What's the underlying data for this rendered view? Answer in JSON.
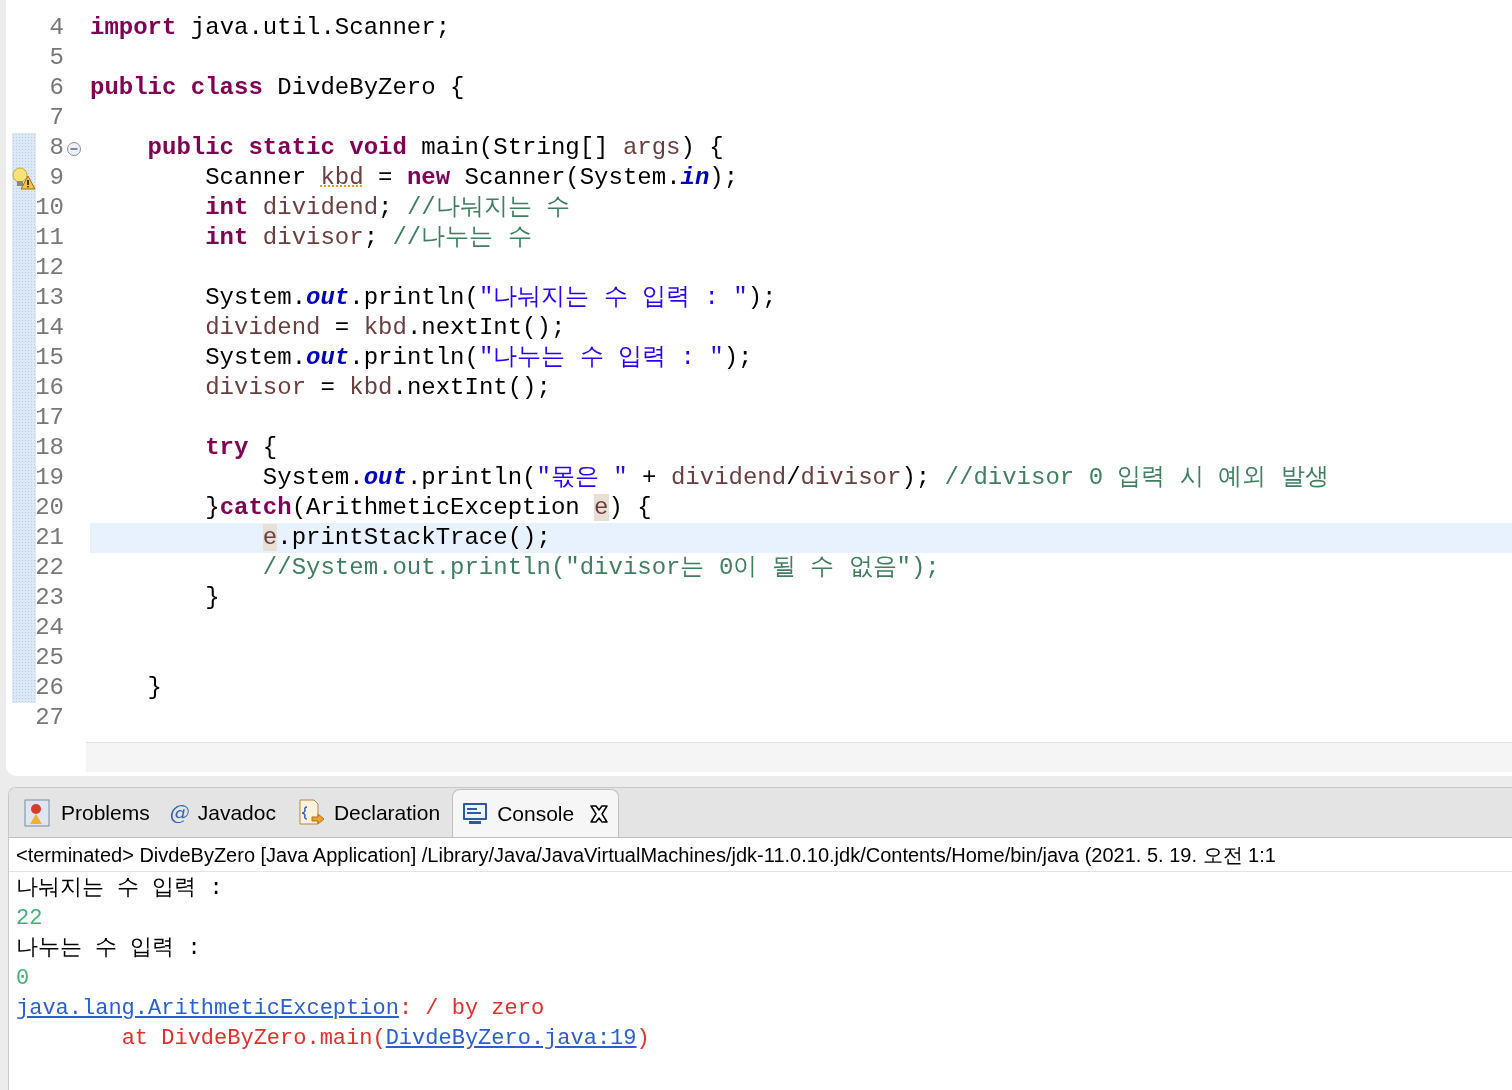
{
  "editor": {
    "lines": [
      {
        "number": "4",
        "current": false,
        "in_range": false,
        "tokens": [
          {
            "kind": "keyword",
            "text": "import"
          },
          {
            "kind": "plain",
            "text": " java.util.Scanner;"
          }
        ]
      },
      {
        "number": "5",
        "current": false,
        "in_range": false
      },
      {
        "number": "6",
        "current": false,
        "in_range": false,
        "tokens": [
          {
            "kind": "keyword",
            "text": "public class"
          },
          {
            "kind": "plain",
            "text": " DivdeByZero {"
          }
        ]
      },
      {
        "number": "7",
        "current": false,
        "in_range": false
      },
      {
        "number": "8",
        "current": false,
        "in_range": true,
        "kind": "fold",
        "tokens": [
          {
            "kind": "keyword",
            "text": "    public static void"
          },
          {
            "kind": "plain",
            "text": " main(String[] "
          },
          {
            "kind": "local",
            "text": "args"
          },
          {
            "kind": "plain",
            "text": ") {"
          }
        ]
      },
      {
        "number": "9",
        "current": false,
        "in_range": true,
        "kind": "warning",
        "tokens": [
          {
            "kind": "plain",
            "text": "        Scanner "
          },
          {
            "kind": "warning",
            "text": "kbd"
          },
          {
            "kind": "plain",
            "text": " = "
          },
          {
            "kind": "keyword",
            "text": "new"
          },
          {
            "kind": "plain",
            "text": " Scanner(System."
          },
          {
            "kind": "field",
            "text": "in"
          },
          {
            "kind": "plain",
            "text": ");"
          }
        ]
      },
      {
        "number": "10",
        "current": false,
        "in_range": true,
        "tokens": [
          {
            "kind": "keyword",
            "text": "        int"
          },
          {
            "kind": "local",
            "text": " dividend"
          },
          {
            "kind": "plain",
            "text": "; "
          },
          {
            "kind": "comment",
            "text": "//나눠지는 수"
          }
        ]
      },
      {
        "number": "11",
        "current": false,
        "in_range": true,
        "tokens": [
          {
            "kind": "keyword",
            "text": "        int"
          },
          {
            "kind": "local",
            "text": " divisor"
          },
          {
            "kind": "plain",
            "text": "; "
          },
          {
            "kind": "comment",
            "text": "//나누는 수"
          }
        ]
      },
      {
        "number": "12",
        "current": false,
        "in_range": true
      },
      {
        "number": "13",
        "current": false,
        "in_range": true,
        "tokens": [
          {
            "kind": "plain",
            "text": "        System."
          },
          {
            "kind": "field",
            "text": "out"
          },
          {
            "kind": "plain",
            "text": ".println("
          },
          {
            "kind": "string",
            "text": "\"나눠지는 수 입력 : \""
          },
          {
            "kind": "plain",
            "text": ");"
          }
        ]
      },
      {
        "number": "14",
        "current": false,
        "in_range": true,
        "tokens": [
          {
            "kind": "local",
            "text": "        dividend"
          },
          {
            "kind": "plain",
            "text": " = "
          },
          {
            "kind": "local",
            "text": "kbd"
          },
          {
            "kind": "plain",
            "text": ".nextInt();"
          }
        ]
      },
      {
        "number": "15",
        "current": false,
        "in_range": true,
        "tokens": [
          {
            "kind": "plain",
            "text": "        System."
          },
          {
            "kind": "field",
            "text": "out"
          },
          {
            "kind": "plain",
            "text": ".println("
          },
          {
            "kind": "string",
            "text": "\"나누는 수 입력 : \""
          },
          {
            "kind": "plain",
            "text": ");"
          }
        ]
      },
      {
        "number": "16",
        "current": false,
        "in_range": true,
        "tokens": [
          {
            "kind": "local",
            "text": "        divisor"
          },
          {
            "kind": "plain",
            "text": " = "
          },
          {
            "kind": "local",
            "text": "kbd"
          },
          {
            "kind": "plain",
            "text": ".nextInt();"
          }
        ]
      },
      {
        "number": "17",
        "current": false,
        "in_range": true
      },
      {
        "number": "18",
        "current": false,
        "in_range": true,
        "tokens": [
          {
            "kind": "keyword",
            "text": "        try"
          },
          {
            "kind": "plain",
            "text": " {"
          }
        ]
      },
      {
        "number": "19",
        "current": false,
        "in_range": true,
        "tokens": [
          {
            "kind": "plain",
            "text": "            System."
          },
          {
            "kind": "field",
            "text": "out"
          },
          {
            "kind": "plain",
            "text": ".println("
          },
          {
            "kind": "string",
            "text": "\"몫은 \""
          },
          {
            "kind": "plain",
            "text": " + "
          },
          {
            "kind": "local",
            "text": "dividend"
          },
          {
            "kind": "plain",
            "text": "/"
          },
          {
            "kind": "local",
            "text": "divisor"
          },
          {
            "kind": "plain",
            "text": "); "
          },
          {
            "kind": "comment",
            "text": "//divisor 0 입력 시 예외 발생"
          }
        ]
      },
      {
        "number": "20",
        "current": false,
        "in_range": true,
        "tokens": [
          {
            "kind": "plain",
            "text": "        }"
          },
          {
            "kind": "keyword",
            "text": "catch"
          },
          {
            "kind": "plain",
            "text": "(ArithmeticException "
          },
          {
            "kind": "occurrence",
            "text": "e"
          },
          {
            "kind": "plain",
            "text": ") {"
          }
        ]
      },
      {
        "number": "21",
        "current": true,
        "in_range": true,
        "tokens": [
          {
            "kind": "occurrence",
            "text": "            e"
          },
          {
            "kind": "plain",
            "text": ".printStackTrace();"
          }
        ]
      },
      {
        "number": "22",
        "current": false,
        "in_range": true,
        "tokens": [
          {
            "kind": "comment",
            "text": "            //System.out.println(\"divisor는 0이 될 수 없음\");"
          }
        ]
      },
      {
        "number": "23",
        "current": false,
        "in_range": true,
        "tokens": [
          {
            "kind": "plain",
            "text": "        }"
          }
        ]
      },
      {
        "number": "24",
        "current": false,
        "in_range": true
      },
      {
        "number": "25",
        "current": false,
        "in_range": true
      },
      {
        "number": "26",
        "current": false,
        "in_range": true,
        "tokens": [
          {
            "kind": "plain",
            "text": "    }"
          }
        ]
      },
      {
        "number": "27",
        "current": false,
        "in_range": false
      }
    ]
  },
  "tabs": [
    {
      "kind": "problems",
      "label": "Problems",
      "selected": false
    },
    {
      "kind": "javadoc",
      "glyph": "@",
      "label": "Javadoc",
      "selected": false
    },
    {
      "kind": "declaration",
      "label": "Declaration",
      "selected": false
    },
    {
      "kind": "console",
      "label": "Console",
      "selected": true
    }
  ],
  "console": {
    "header": "<terminated> DivdeByZero [Java Application] /Library/Java/JavaVirtualMachines/jdk-11.0.10.jdk/Contents/Home/bin/java (2021. 5. 19. 오전 1:1",
    "lines": [
      [
        {
          "kind": "output",
          "text": "나눠지는 수 입력 : "
        }
      ],
      [
        {
          "kind": "input",
          "text": "22"
        }
      ],
      [
        {
          "kind": "output",
          "text": "나누는 수 입력 : "
        }
      ],
      [
        {
          "kind": "input",
          "text": "0"
        }
      ],
      [
        {
          "kind": "link",
          "text": "java.lang.ArithmeticException"
        },
        {
          "kind": "error",
          "text": ": / by zero"
        }
      ],
      [
        {
          "kind": "error",
          "text": "\tat DivdeByZero.main("
        },
        {
          "kind": "link",
          "text": "DivdeByZero.java:19"
        },
        {
          "kind": "error",
          "text": ")"
        }
      ]
    ]
  }
}
